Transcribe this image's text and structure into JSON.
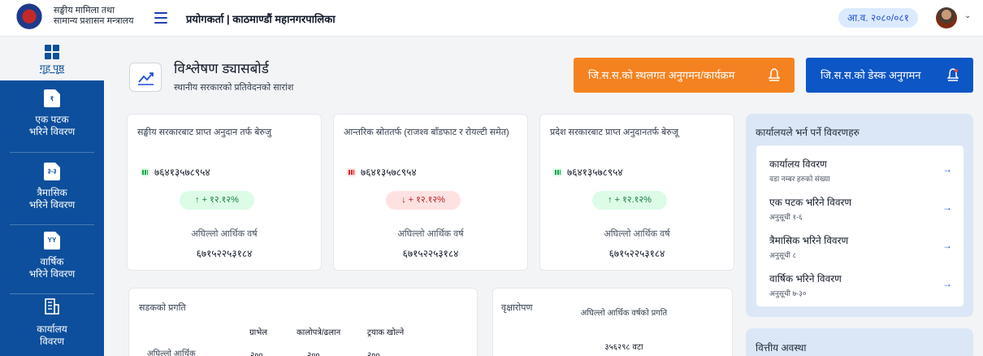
{
  "header": {
    "org_line1": "सङ्घीय मामिला तथा",
    "org_line2": "सामान्य प्रशासन मन्त्रालय",
    "user_title": "प्रयोगकर्ता | काठमाण्डौं महानगरपालिका",
    "fiscal_year": "आ.व. २०८०/०८१"
  },
  "sidebar": {
    "items": [
      {
        "label_1": "गृह पृष्ठ",
        "label_2": "",
        "icon": "grid-icon"
      },
      {
        "label_1": "एक पटक",
        "label_2": "भरिने विवरण",
        "icon_text": "१"
      },
      {
        "label_1": "त्रैमासिक",
        "label_2": "भरिने विवरण",
        "icon_text": "३-३"
      },
      {
        "label_1": "वार्षिक",
        "label_2": "भरिने विवरण",
        "icon_text": "YY"
      },
      {
        "label_1": "कार्यालय",
        "label_2": "विवरण",
        "icon": "building-icon"
      }
    ]
  },
  "dashboard": {
    "title": "विश्लेषण ड्यासबोर्ड",
    "subtitle": "स्थानीय सरकारको प्रतिवेदनको सारांश",
    "btn_field_monitoring": "जि.स.स.को स्थलगत अनुगमन/कार्यक्रम",
    "btn_desk_monitoring": "जि.स.स.को डेस्क अनुगमन"
  },
  "stats": [
    {
      "title": "सङ्घीय सरकारबाट प्राप्त अनुदान तर्फ बेरुजु",
      "value": "७६४१३५७८९५४",
      "change": "↑ + १२.१२%",
      "trend": "up",
      "prev_label": "अघिल्लो आर्थिक वर्ष",
      "prev_value": "६७१५२२५३१८४"
    },
    {
      "title": "आन्तरिक स्रोततर्फ (राजश्व बाँडफाट र रोयल्टी समेत)",
      "value": "७६४१३५७८९५४",
      "change": "↓ + १२.१२%",
      "trend": "down",
      "prev_label": "अघिल्लो आर्थिक वर्ष",
      "prev_value": "६७१५२२५३१८४"
    },
    {
      "title": "प्रदेश सरकारबाट प्राप्त अनुदानतर्फ बेरुजू",
      "value": "७६४१३५७८९५४",
      "change": "↑ + १२.१२%",
      "trend": "up",
      "prev_label": "अघिल्लो आर्थिक वर्ष",
      "prev_value": "६७१५२२५३१८४"
    }
  ],
  "right_panel": {
    "title": "कार्यालयले भर्न पर्ने विवरणहरु",
    "items": [
      {
        "title": "कार्यालय विवरण",
        "sub": "वडा नम्बर हरुको संख्या"
      },
      {
        "title": "एक पटक भरिने विवरण",
        "sub": "अनुसूची १-६"
      },
      {
        "title": "त्रैमासिक भरिने विवरण",
        "sub": "अनुसूची ८"
      },
      {
        "title": "वार्षिक भरिने विवरण",
        "sub": "अनुसूची ७-३०"
      }
    ],
    "arrow": "→"
  },
  "finance": {
    "title": "वित्तीय अवस्था"
  },
  "road": {
    "title": "सडकको प्रगति",
    "columns": [
      "ग्राभेल",
      "कालोपत्रे/ढलान",
      "ट्रयाक खोल्ने"
    ],
    "row_label": "अघिल्लो आर्थिक",
    "row_values": [
      "२००",
      "२००",
      "२००"
    ]
  },
  "tree": {
    "title": "वृक्षारोपण",
    "label": "अघिल्लो आर्थिक वर्षको प्रगति",
    "value": "३५६२९८ वटा"
  }
}
